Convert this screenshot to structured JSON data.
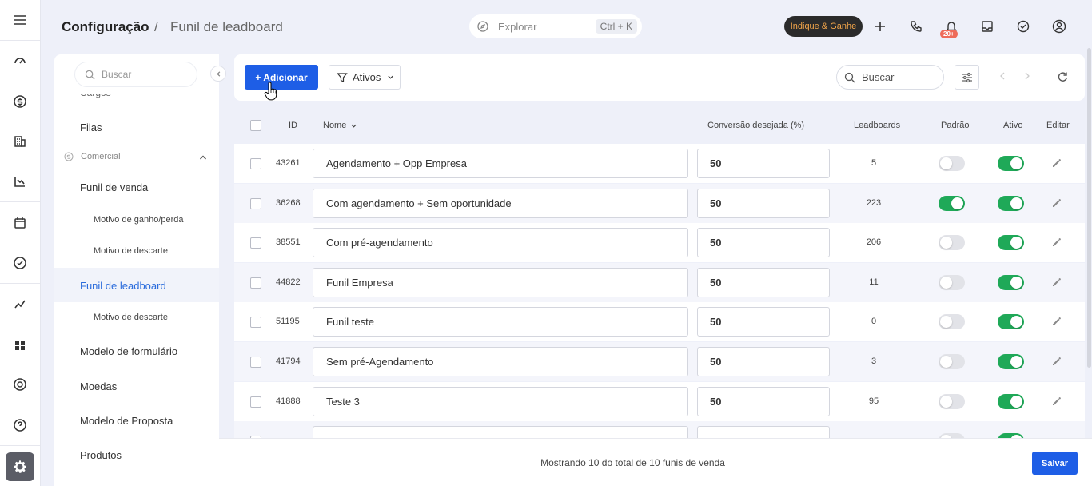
{
  "header": {
    "title": "Configuração",
    "separator": "/",
    "subtitle": "Funil de leadboard",
    "explore_placeholder": "Explorar",
    "explore_shortcut": "Ctrl + K",
    "indique_label": "Indique & Ganhe",
    "notification_badge": "20+"
  },
  "subnav": {
    "search_placeholder": "Buscar",
    "cut_item": "Cargos",
    "items": {
      "filas": "Filas",
      "comercial": "Comercial",
      "funil_venda": "Funil de venda",
      "motivo_ganho": "Motivo de ganho/perda",
      "motivo_descarte_1": "Motivo de descarte",
      "funil_leadboard": "Funil de leadboard",
      "motivo_descarte_2": "Motivo de descarte",
      "modelo_formulario": "Modelo de formulário",
      "moedas": "Moedas",
      "modelo_proposta": "Modelo de Proposta",
      "produtos": "Produtos"
    }
  },
  "toolbar": {
    "add_label": "+ Adicionar",
    "filter_label": "Ativos",
    "search_placeholder": "Buscar"
  },
  "table": {
    "columns": {
      "id": "ID",
      "nome": "Nome",
      "conversao": "Conversão desejada (%)",
      "leadboards": "Leadboards",
      "padrao": "Padrão",
      "ativo": "Ativo",
      "editar": "Editar"
    },
    "rows": [
      {
        "id": "43261",
        "nome": "Agendamento + Opp Empresa",
        "conversao": "50",
        "leadboards": "5",
        "padrao": false,
        "ativo": true
      },
      {
        "id": "36268",
        "nome": "Com agendamento + Sem oportunidade",
        "conversao": "50",
        "leadboards": "223",
        "padrao": true,
        "ativo": true
      },
      {
        "id": "38551",
        "nome": "Com pré-agendamento",
        "conversao": "50",
        "leadboards": "206",
        "padrao": false,
        "ativo": true
      },
      {
        "id": "44822",
        "nome": "Funil Empresa",
        "conversao": "50",
        "leadboards": "11",
        "padrao": false,
        "ativo": true
      },
      {
        "id": "51195",
        "nome": "Funil teste",
        "conversao": "50",
        "leadboards": "0",
        "padrao": false,
        "ativo": true
      },
      {
        "id": "41794",
        "nome": "Sem pré-Agendamento",
        "conversao": "50",
        "leadboards": "3",
        "padrao": false,
        "ativo": true
      },
      {
        "id": "41888",
        "nome": "Teste 3",
        "conversao": "50",
        "leadboards": "95",
        "padrao": false,
        "ativo": true
      }
    ]
  },
  "footer": {
    "summary": "Mostrando 10 do total de 10 funis de venda",
    "save_label": "Salvar"
  },
  "colors": {
    "primary": "#1e5ee6",
    "toggle_on": "#1fa958",
    "active_nav": "#2b6cdc",
    "indique_text": "#f2a54a"
  }
}
